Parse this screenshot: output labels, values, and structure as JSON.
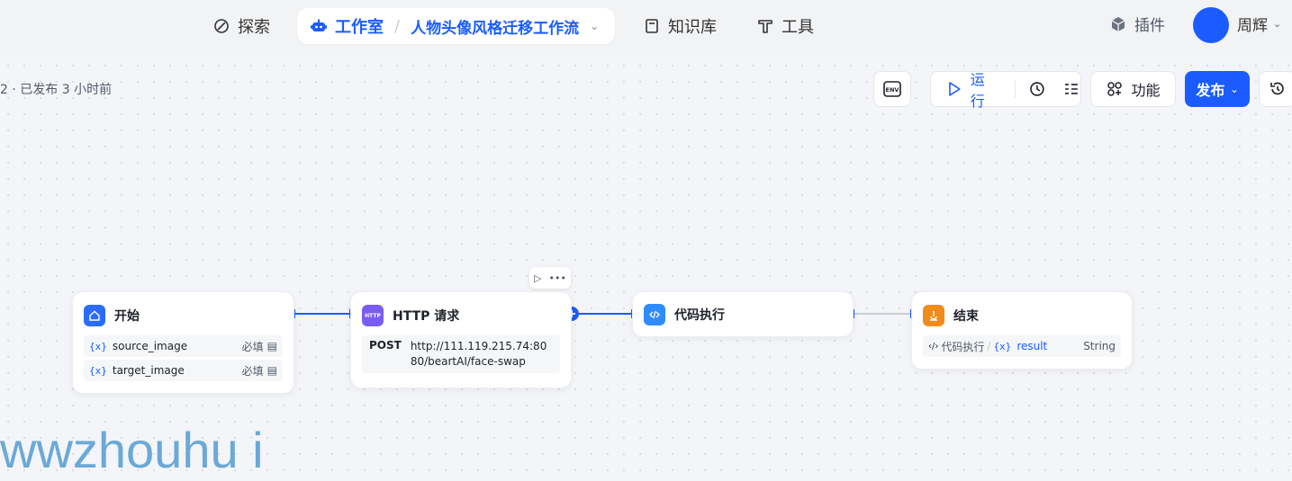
{
  "nav": {
    "explore": "探索",
    "studio": "工作室",
    "workflow_name": "人物头像风格迁移工作流",
    "knowledge": "知识库",
    "tools": "工具",
    "plugins": "插件",
    "user_name": "周辉"
  },
  "canvas": {
    "publish_status": "2 · 已发布 3 小时前",
    "env_label": "ENV",
    "run_label": "运行",
    "features_label": "功能",
    "publish_label": "发布"
  },
  "nodes": {
    "start": {
      "title": "开始",
      "params": [
        {
          "tag": "{x}",
          "name": "source_image",
          "required": "必填"
        },
        {
          "tag": "{x}",
          "name": "target_image",
          "required": "必填"
        }
      ]
    },
    "http": {
      "title": "HTTP 请求",
      "icon_text": "HTTP",
      "method": "POST",
      "url": "http://111.119.215.74:8080/beartAI/face-swap"
    },
    "code": {
      "title": "代码执行"
    },
    "end": {
      "title": "结束",
      "source": "代码执行",
      "tag": "{x}",
      "result": "result",
      "type": "String"
    }
  },
  "watermark": "wwzhouhu i",
  "colors": {
    "accent": "#1a5cff",
    "start_icon": "#2b6cff",
    "http_icon": "#7a5cf5",
    "code_icon": "#2f8cff",
    "end_icon": "#f08c1a"
  }
}
